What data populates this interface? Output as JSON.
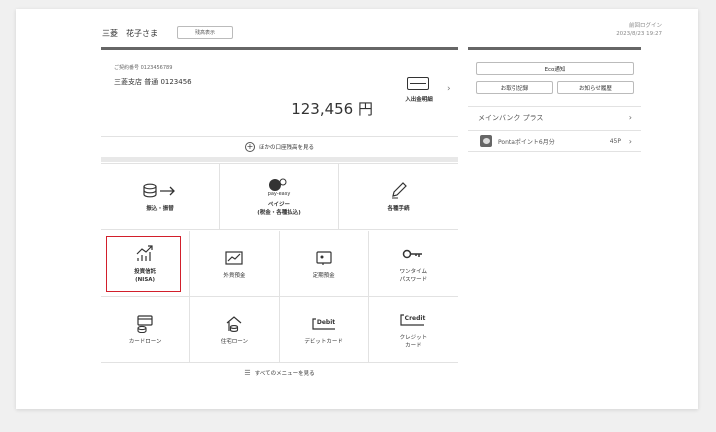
{
  "header": {
    "greeting": "三菱　花子さま",
    "hide_balance_label": "残高表示",
    "last_login_label": "前回ログイン",
    "last_login_time": "2023/8/23 19:27"
  },
  "account": {
    "customer_no": "ご契約番号 0123456789",
    "branch": "三菱支店 普通 0123456",
    "balance": "123,456 円",
    "statement_label": "入出金明細"
  },
  "other_accounts_label": "ほかの口座残高を見る",
  "menu_top": [
    {
      "label": "振込・振替"
    },
    {
      "label": "ペイジー\n(税金・各種払込)"
    },
    {
      "label": "各種手続"
    }
  ],
  "menu_mid": [
    {
      "label": "投資信託\n(NISA)"
    },
    {
      "label": "外貨預金"
    },
    {
      "label": "定期預金"
    },
    {
      "label": "ワンタイム\nパスワード"
    }
  ],
  "menu_bottom": [
    {
      "label": "カードローン"
    },
    {
      "label": "住宅ローン"
    },
    {
      "label": "デビットカード"
    },
    {
      "label": "クレジット\nカード"
    }
  ],
  "payeasy_badge": "pay-easy",
  "debit_badge": "Debit",
  "credit_badge": "Credit",
  "all_menu_label": "すべてのメニューを見る",
  "side": {
    "eco_label": "Eco通知",
    "history_label": "お取引記録",
    "notice_label": "お知らせ履歴",
    "mainbank_label": "メインバンク プラス",
    "ponta_label": "Pontaポイント6月分",
    "ponta_points": "45P"
  },
  "colors": {
    "highlight": "#d21f2b",
    "topline": "#666666"
  }
}
